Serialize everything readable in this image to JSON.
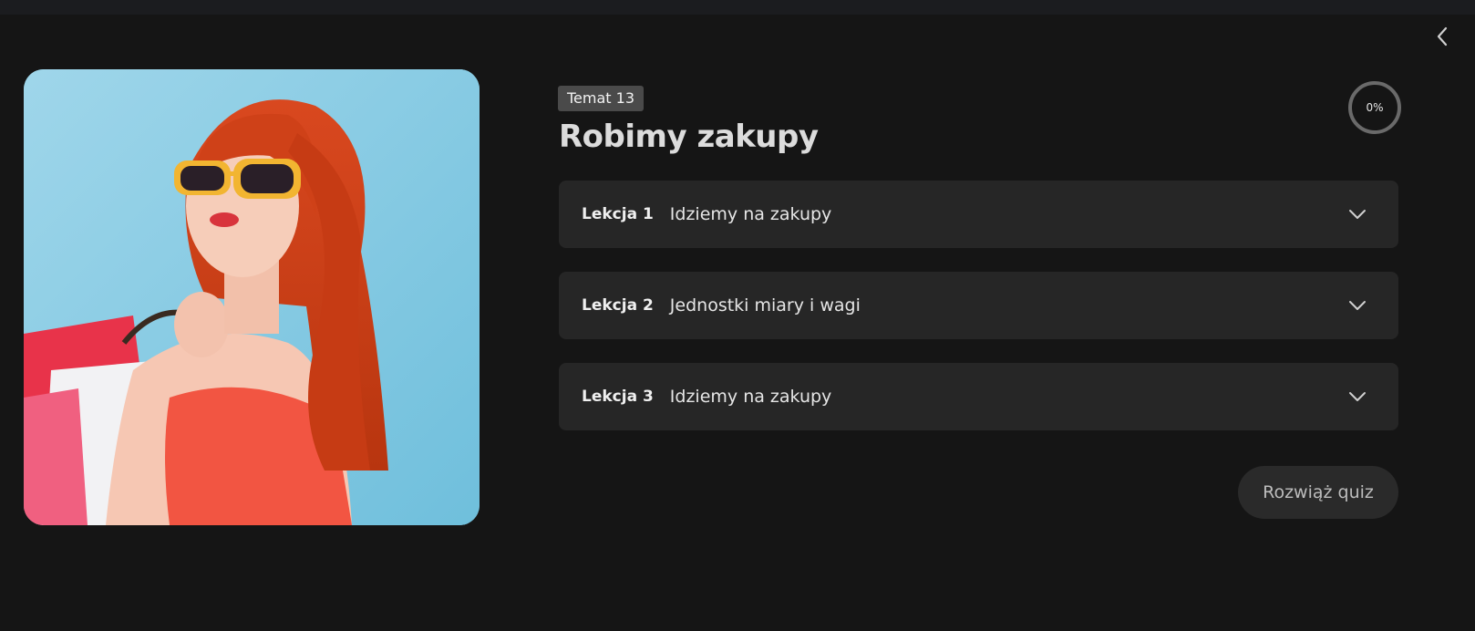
{
  "topic": {
    "badge": "Temat 13",
    "title": "Robimy zakupy",
    "progress": "0%",
    "progress_value": 0
  },
  "lessons": [
    {
      "number": "Lekcja 1",
      "title": "Idziemy na zakupy"
    },
    {
      "number": "Lekcja 2",
      "title": "Jednostki miary i wagi"
    },
    {
      "number": "Lekcja 3",
      "title": "Idziemy na zakupy"
    }
  ],
  "actions": {
    "quiz_label": "Rozwiąż quiz"
  },
  "icons": {
    "back": "chevron-left-icon",
    "expand": "chevron-down-icon"
  },
  "colors": {
    "background": "#151515",
    "card": "#262626",
    "badge": "#4a4a4a",
    "progress_ring": "#6a6a6a"
  }
}
